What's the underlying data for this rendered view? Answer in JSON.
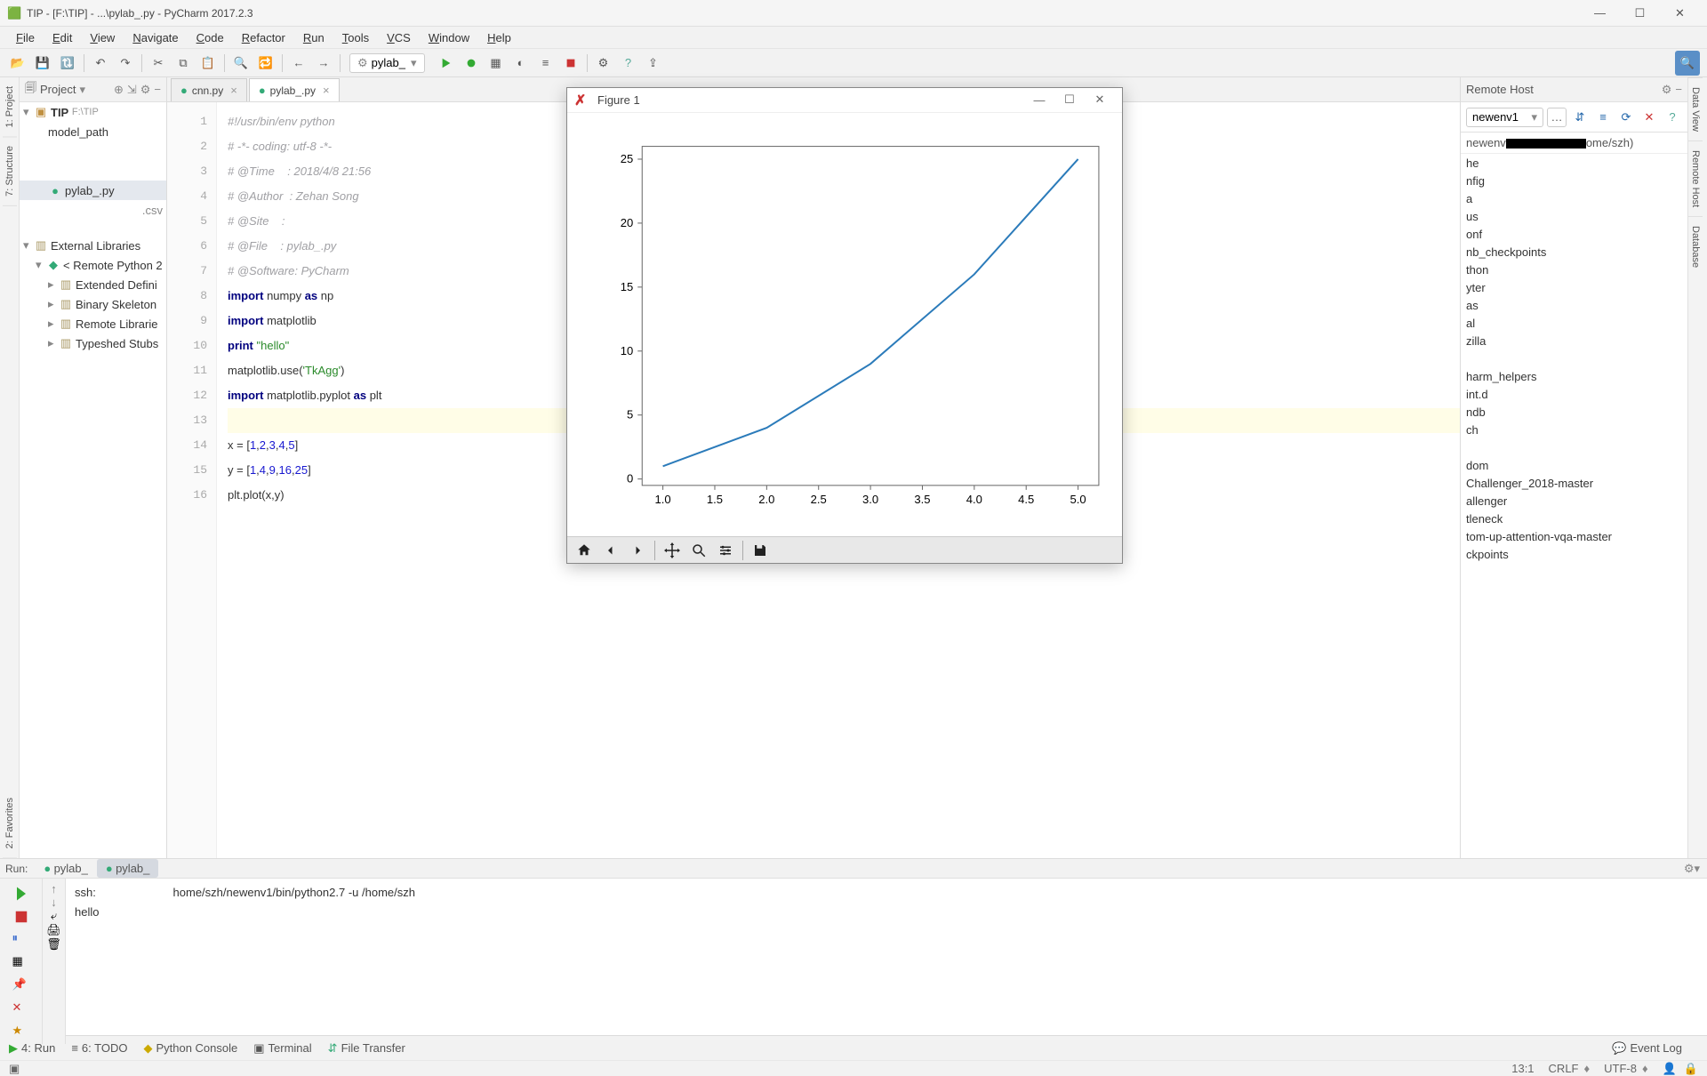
{
  "title_bar": {
    "text": "TIP - [F:\\TIP] - ...\\pylab_.py - PyCharm 2017.2.3"
  },
  "menu": {
    "items": [
      "File",
      "Edit",
      "View",
      "Navigate",
      "Code",
      "Refactor",
      "Run",
      "Tools",
      "VCS",
      "Window",
      "Help"
    ]
  },
  "run_config": {
    "name": "pylab_"
  },
  "tabs": [
    {
      "name": "cnn.py",
      "active": false
    },
    {
      "name": "pylab_.py",
      "active": true
    }
  ],
  "project": {
    "header": "Project",
    "root": {
      "name": "TIP",
      "path": "F:\\TIP"
    },
    "items": [
      {
        "indent": 1,
        "label": "model_path",
        "kind": "folder"
      },
      {
        "indent": 1,
        "label": "pylab_.py",
        "kind": "py",
        "sel": true
      },
      {
        "indent": 1,
        "label": ".csv",
        "kind": "csv",
        "align": "right"
      }
    ],
    "ext_lib": "External Libraries",
    "remote_node": "< Remote Python 2",
    "ext_children": [
      "Extended Defini",
      "Binary Skeleton",
      "Remote Librarie",
      "Typeshed Stubs"
    ]
  },
  "code": {
    "first_line": 1,
    "lines": [
      {
        "t": "#!/usr/bin/env python",
        "c": "cm"
      },
      {
        "t": "# -*- coding: utf-8 -*-",
        "c": "cm"
      },
      {
        "t": "# @Time    : 2018/4/8 21:56",
        "c": "cm"
      },
      {
        "t": "# @Author  : Zehan Song",
        "c": "cm"
      },
      {
        "t": "# @Site    : ",
        "c": "cm"
      },
      {
        "t": "# @File    : pylab_.py",
        "c": "cm"
      },
      {
        "t": "# @Software: PyCharm",
        "c": "cm"
      },
      {
        "raw": "<span class='kw'>import</span> numpy <span class='kw'>as</span> np"
      },
      {
        "raw": "<span class='kw'>import</span> matplotlib"
      },
      {
        "raw": "<span class='kw'>print</span> <span class='str'>\"hello\"</span>"
      },
      {
        "raw": "matplotlib.use(<span class='str'>'TkAgg'</span>)"
      },
      {
        "raw": "<span class='kw'>import</span> matplotlib.pyplot <span class='kw'>as</span> plt"
      },
      {
        "raw": "",
        "cl": "cl13"
      },
      {
        "raw": "x = [<span class='num'>1</span>,<span class='num'>2</span>,<span class='num'>3</span>,<span class='num'>4</span>,<span class='num'>5</span>]"
      },
      {
        "raw": "y = [<span class='num'>1</span>,<span class='num'>4</span>,<span class='num'>9</span>,<span class='num'>16</span>,<span class='num'>25</span>]"
      },
      {
        "raw": "plt.plot(x,y)"
      }
    ]
  },
  "remote": {
    "header": "Remote Host",
    "env_name": "newenv1",
    "path_left": "newenv",
    "path_right": "ome/szh)",
    "items": [
      "he",
      "nfig",
      "a",
      "us",
      "onf",
      "nb_checkpoints",
      "thon",
      "yter",
      "as",
      "al",
      "zilla",
      "",
      "harm_helpers",
      "int.d",
      "ndb",
      "ch",
      "",
      "dom",
      "Challenger_2018-master",
      "allenger",
      "tleneck",
      "tom-up-attention-vqa-master",
      "ckpoints"
    ]
  },
  "run": {
    "label": "Run:",
    "tabs": [
      "pylab_",
      "pylab_"
    ],
    "active_tab": 1,
    "console_line1": "ssh:                        home/szh/newenv1/bin/python2.7 -u /home/szh",
    "console_line2": "hello"
  },
  "bottom_bar": {
    "items": [
      "4: Run",
      "6: TODO",
      "Python Console",
      "Terminal",
      "File Transfer"
    ],
    "event_log": "Event Log"
  },
  "status_bar": {
    "pos": "13:1",
    "line_ending": "CRLF",
    "encoding": "UTF-8"
  },
  "left_tabs": [
    "1: Project",
    "7: Structure",
    "2: Favorites"
  ],
  "right_tabs": [
    "Data View",
    "Remote Host",
    "Database"
  ],
  "figure": {
    "title": "Figure 1",
    "toolbar": [
      "home",
      "back",
      "forward",
      "pan",
      "zoom",
      "configure",
      "save"
    ]
  },
  "chart_data": {
    "type": "line",
    "x": [
      1,
      2,
      3,
      4,
      5
    ],
    "y": [
      1,
      4,
      9,
      16,
      25
    ],
    "xlim": [
      0.8,
      5.2
    ],
    "ylim": [
      -0.5,
      26
    ],
    "xticks": [
      1.0,
      1.5,
      2.0,
      2.5,
      3.0,
      3.5,
      4.0,
      4.5,
      5.0
    ],
    "yticks": [
      0,
      5,
      10,
      15,
      20,
      25
    ],
    "title": "",
    "xlabel": "",
    "ylabel": ""
  }
}
